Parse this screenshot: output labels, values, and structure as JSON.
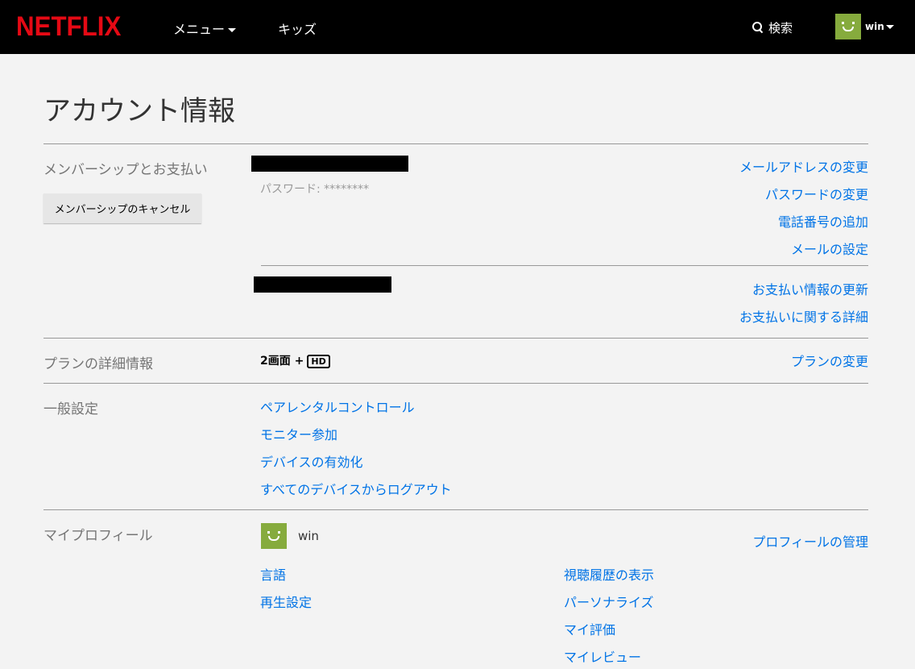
{
  "header": {
    "logo": "NETFLIX",
    "menu_label": "メニュー",
    "kids_label": "キッズ",
    "search_label": "検索",
    "profile_name": "win"
  },
  "page": {
    "title": "アカウント情報"
  },
  "membership": {
    "label": "メンバーシップとお支払い",
    "cancel_button": "メンバーシップのキャンセル",
    "password_text": "パスワード: ********",
    "links": [
      "メールアドレスの変更",
      "パスワードの変更",
      "電話番号の追加",
      "メールの設定"
    ],
    "payment_links": [
      "お支払い情報の更新",
      "お支払いに関する詳細"
    ]
  },
  "plan": {
    "label": "プランの詳細情報",
    "value": "2画面 +",
    "badge": "HD",
    "change_link": "プランの変更"
  },
  "general": {
    "label": "一般設定",
    "links": [
      "ペアレンタルコントロール",
      "モニター参加",
      "デバイスの有効化",
      "すべてのデバイスからログアウト"
    ]
  },
  "profiles": {
    "label": "マイプロフィール",
    "profile_name": "win",
    "manage_link": "プロフィールの管理",
    "left_links": [
      "言語",
      "再生設定"
    ],
    "right_links": [
      "視聴履歴の表示",
      "パーソナライズ",
      "マイ評価",
      "マイレビュー"
    ]
  },
  "colors": {
    "brand": "#e50914",
    "link": "#0073e6",
    "avatar": "#86ab3d"
  }
}
